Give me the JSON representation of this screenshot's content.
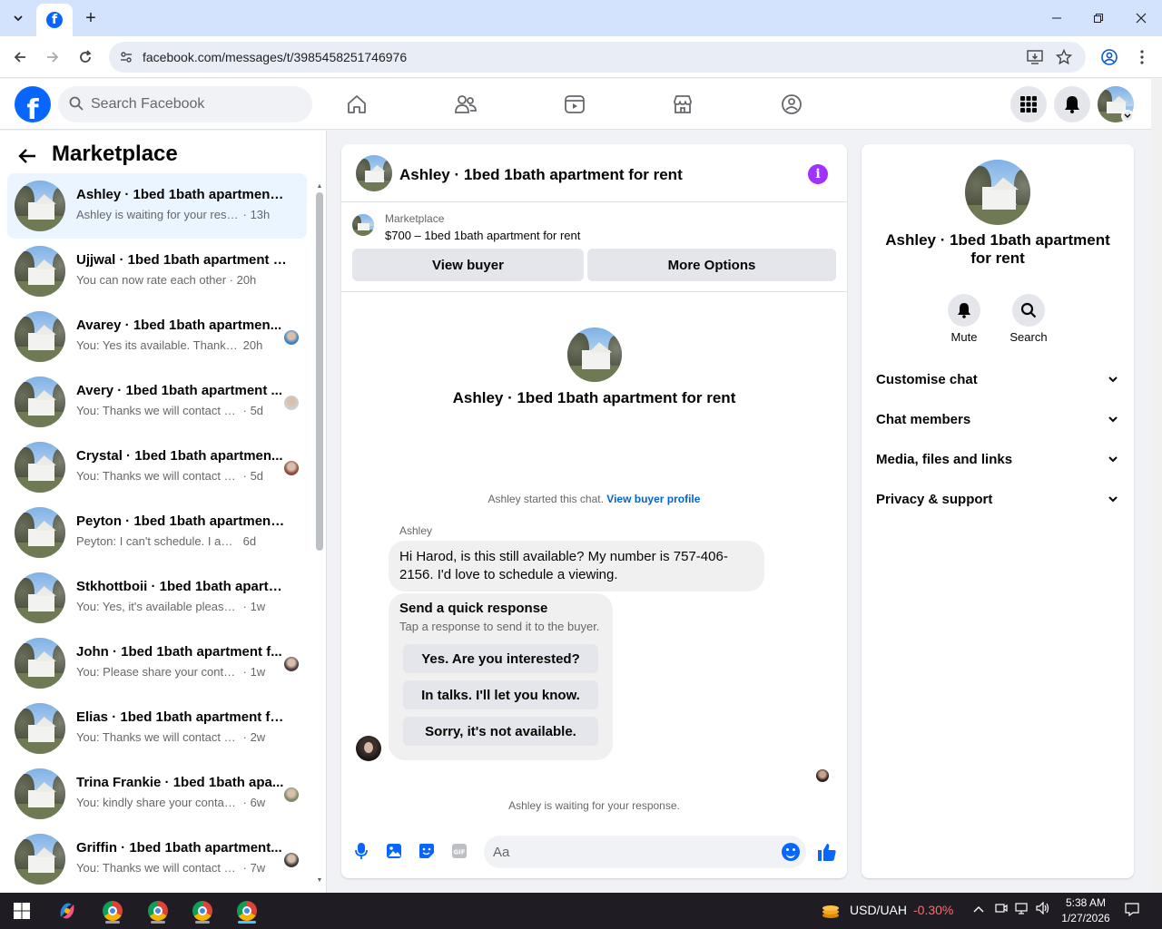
{
  "browser": {
    "url": "facebook.com/messages/t/3985458251746976",
    "tab_icon": "facebook-icon"
  },
  "fb": {
    "logo": "f",
    "search_placeholder": "Search Facebook"
  },
  "sidebar": {
    "title": "Marketplace",
    "conversations": [
      {
        "title": "Ashley · 1bed 1bath apartment f...",
        "snippet": "Ashley is waiting for your response.",
        "time": "· 13h",
        "active": true
      },
      {
        "title": "Ujjwal · 1bed 1bath apartment fo...",
        "snippet": "You can now rate each other",
        "time": "· 20h"
      },
      {
        "title": "Avarey · 1bed 1bath apartmen...",
        "snippet": "You: Yes its available. Thanks fo...",
        "time": "20h"
      },
      {
        "title": "Avery · 1bed 1bath apartment ...",
        "snippet": "You: Thanks we will contact soo...",
        "time": "· 5d"
      },
      {
        "title": "Crystal · 1bed 1bath apartmen...",
        "snippet": "You: Thanks we will contact soo...",
        "time": "· 5d"
      },
      {
        "title": "Peyton · 1bed 1bath apartment f...",
        "snippet": "Peyton: I can't schedule. I am out of...",
        "time": "6d"
      },
      {
        "title": "Stkhottboii · 1bed 1bath apartm...",
        "snippet": "You: Yes, it's available please drop ...",
        "time": "· 1w"
      },
      {
        "title": "John · 1bed 1bath apartment f...",
        "snippet": "You: Please share your contact n...",
        "time": "· 1w"
      },
      {
        "title": "Elias · 1bed 1bath apartment for ...",
        "snippet": "You: Thanks we will contact soon w...",
        "time": "· 2w"
      },
      {
        "title": "Trina Frankie · 1bed 1bath apa...",
        "snippet": "You: kindly share your contact n...",
        "time": "· 6w"
      },
      {
        "title": "Griffin · 1bed 1bath apartment...",
        "snippet": "You: Thanks we will contact soo...",
        "time": "· 7w"
      }
    ]
  },
  "chat": {
    "header_title": "Ashley · 1bed 1bath apartment for rent",
    "listing_category": "Marketplace",
    "listing_price": "$700 – 1bed 1bath apartment for rent",
    "view_buyer": "View buyer",
    "more_options": "More Options",
    "intro_title": "Ashley · 1bed 1bath apartment for rent",
    "started_text": "Ashley started this chat.",
    "view_buyer_profile": "View buyer profile",
    "sender": "Ashley",
    "message": "Hi Harod, is this still available? My number is 757-406-2156. I'd love to schedule a viewing.",
    "quick_title": "Send a quick response",
    "quick_sub": "Tap a response to send it to the buyer.",
    "quick_options": [
      "Yes. Are you interested?",
      "In talks. I'll let you know.",
      "Sorry, it's not available."
    ],
    "waiting": "Ashley is waiting for your response.",
    "composer_placeholder": "Aa"
  },
  "details": {
    "title": "Ashley · 1bed 1bath apartment for rent",
    "mute": "Mute",
    "search": "Search",
    "sections": [
      "Customise chat",
      "Chat members",
      "Media, files and links",
      "Privacy & support"
    ]
  },
  "taskbar": {
    "ticker": "USD/UAH",
    "ticker_change": "-0.30%",
    "time": "5:38 AM",
    "date": "1/27/2026"
  },
  "colors": {
    "fb_blue": "#0866ff",
    "active_bg": "#ebf5ff",
    "info_purple": "#a033ff",
    "ticker_red": "#ff6b6b"
  }
}
